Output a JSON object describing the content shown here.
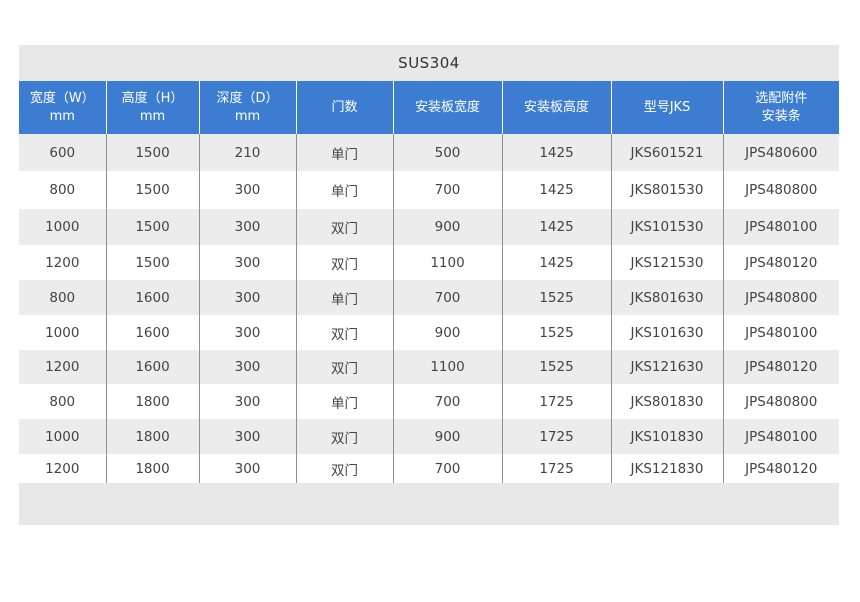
{
  "table": {
    "title": "SUS304",
    "headers": [
      [
        "宽度（W）",
        "mm"
      ],
      [
        "高度（H）",
        "mm"
      ],
      [
        "深度（D）",
        "mm"
      ],
      [
        "门数",
        ""
      ],
      [
        "安装板宽度",
        ""
      ],
      [
        "安装板高度",
        ""
      ],
      [
        "型号JKS",
        ""
      ],
      [
        "选配附件",
        "安装条"
      ]
    ],
    "rows": [
      [
        "600",
        "1500",
        "210",
        "单门",
        "500",
        "1425",
        "JKS601521",
        "JPS480600"
      ],
      [
        "800",
        "1500",
        "300",
        "单门",
        "700",
        "1425",
        "JKS801530",
        "JPS480800"
      ],
      [
        "1000",
        "1500",
        "300",
        "双门",
        "900",
        "1425",
        "JKS101530",
        "JPS480100"
      ],
      [
        "1200",
        "1500",
        "300",
        "双门",
        "1100",
        "1425",
        "JKS121530",
        "JPS480120"
      ],
      [
        "800",
        "1600",
        "300",
        "单门",
        "700",
        "1525",
        "JKS801630",
        "JPS480800"
      ],
      [
        "1000",
        "1600",
        "300",
        "双门",
        "900",
        "1525",
        "JKS101630",
        "JPS480100"
      ],
      [
        "1200",
        "1600",
        "300",
        "双门",
        "1100",
        "1525",
        "JKS121630",
        "JPS480120"
      ],
      [
        "800",
        "1800",
        "300",
        "单门",
        "700",
        "1725",
        "JKS801830",
        "JPS480800"
      ],
      [
        "1000",
        "1800",
        "300",
        "双门",
        "900",
        "1725",
        "JKS101830",
        "JPS480100"
      ],
      [
        "1200",
        "1800",
        "300",
        "双门",
        "700",
        "1725",
        "JKS121830",
        "JPS480120"
      ]
    ]
  }
}
